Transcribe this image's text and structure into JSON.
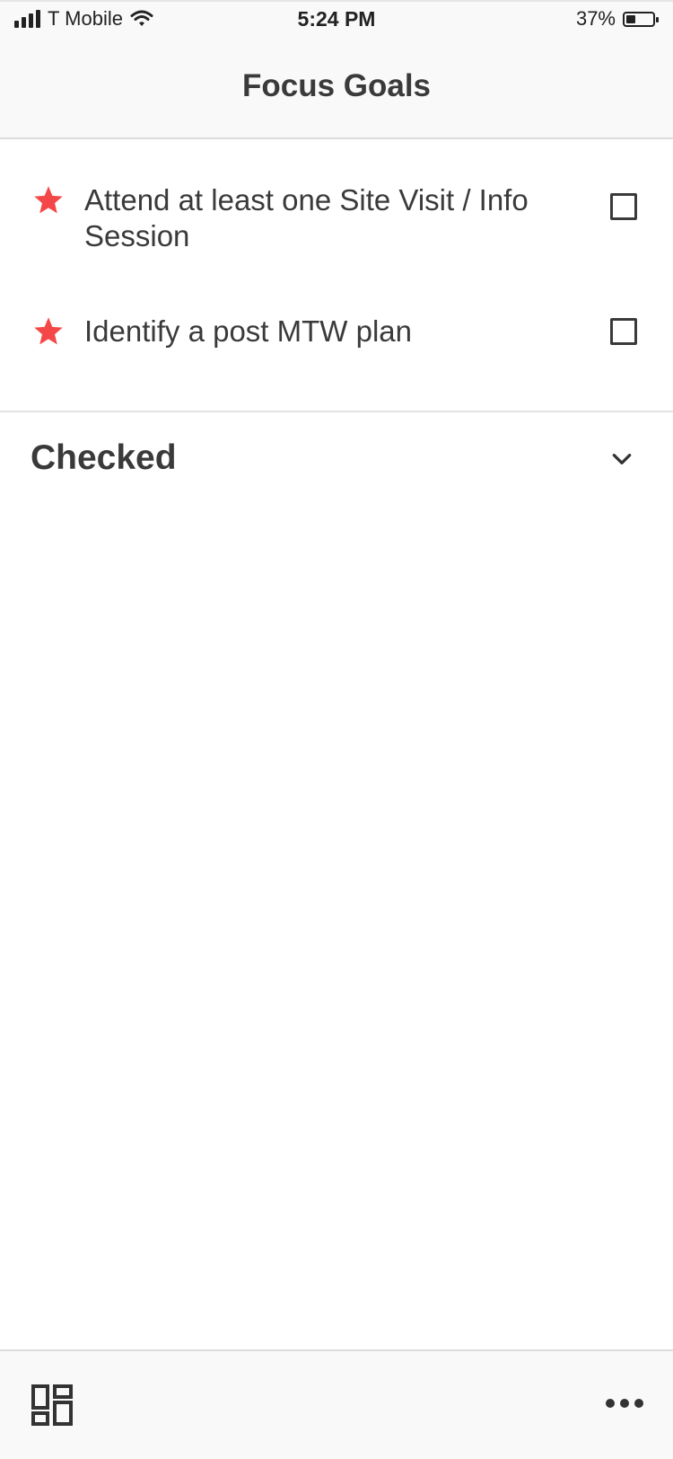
{
  "status_bar": {
    "carrier": "T Mobile",
    "time": "5:24 PM",
    "battery_percent": "37%",
    "battery_level": 0.37,
    "signal_icon": "signal-bars-icon",
    "wifi_icon": "wifi-icon",
    "battery_icon": "battery-charging-icon"
  },
  "header": {
    "title": "Focus Goals"
  },
  "goals": [
    {
      "text": "Attend at least one Site Visit / Info Session",
      "starred": true,
      "checked": false
    },
    {
      "text": "Identify a post MTW plan",
      "starred": true,
      "checked": false
    }
  ],
  "checked_section": {
    "title": "Checked",
    "icon": "chevron-down-icon"
  },
  "bottom_bar": {
    "left_icon": "dashboard-icon",
    "right_icon": "more-icon"
  },
  "colors": {
    "star": "#F44848",
    "text": "#3A3A3A",
    "bar_background": "#F9F9F9",
    "divider": "#E2E2E2"
  }
}
